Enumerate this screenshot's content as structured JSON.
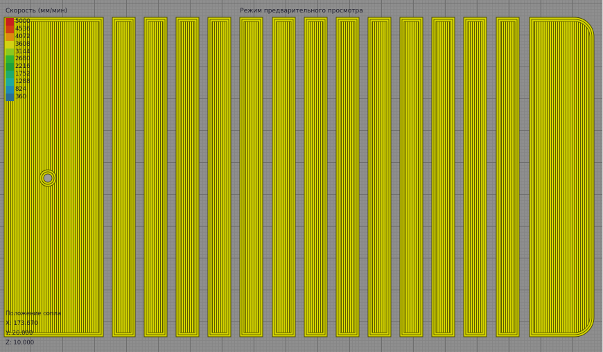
{
  "viewport": {
    "title": "Режим предварительного просмотра"
  },
  "legend": {
    "title": "Скорость (мм/мин)",
    "items": [
      {
        "value": "5000",
        "color": "#c81e1e"
      },
      {
        "value": "4536",
        "color": "#d23c14"
      },
      {
        "value": "4072",
        "color": "#dd8c10"
      },
      {
        "value": "3608",
        "color": "#d2d214"
      },
      {
        "value": "3144",
        "color": "#8cc81e"
      },
      {
        "value": "2680",
        "color": "#32b432"
      },
      {
        "value": "2216",
        "color": "#1ea03c"
      },
      {
        "value": "1752",
        "color": "#1eaa6e"
      },
      {
        "value": "1288",
        "color": "#1eaaa0"
      },
      {
        "value": "824",
        "color": "#1e8cb4"
      },
      {
        "value": "360",
        "color": "#286e96"
      }
    ]
  },
  "nozzle": {
    "title": "Положение сопла",
    "x": "X: 173.670",
    "y": "Y: 20.000",
    "z": "Z: 10.000"
  },
  "colors": {
    "path_fill": "#d4d400",
    "path_line": "#4a4a00"
  }
}
